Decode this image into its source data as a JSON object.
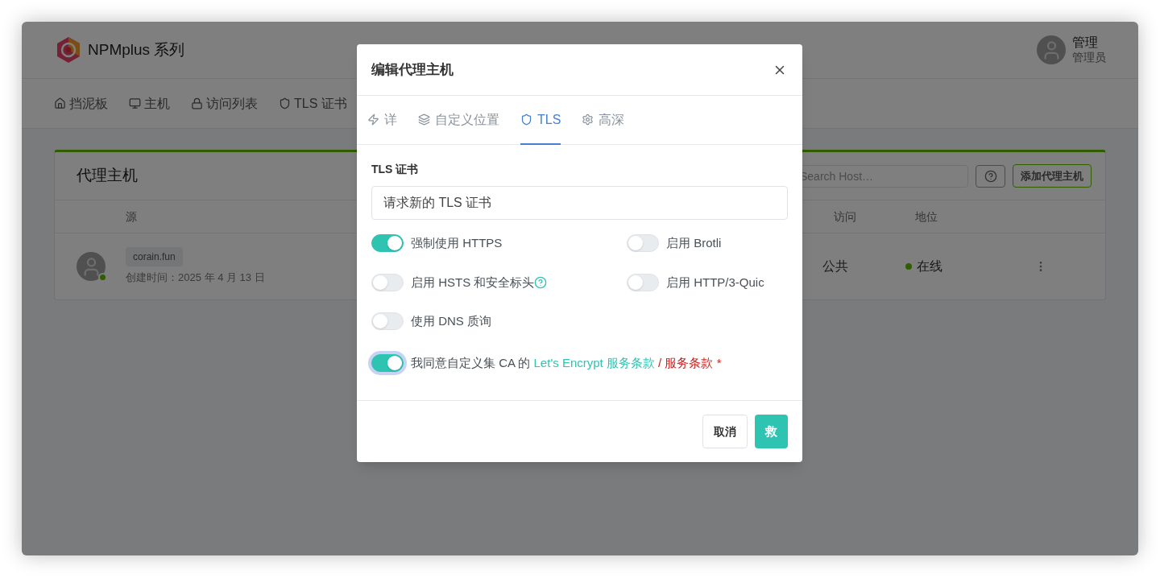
{
  "app": {
    "brand": "NPMplus 系列",
    "user": {
      "name": "管理",
      "role": "管理员"
    },
    "nav": [
      {
        "label": "挡泥板"
      },
      {
        "label": "主机"
      },
      {
        "label": "访问列表"
      },
      {
        "label": "TLS 证书"
      }
    ],
    "card": {
      "title": "代理主机",
      "search": {
        "placeholder": "Search Host…"
      },
      "add_button": "添加代理主机",
      "columns": [
        "源",
        "访问",
        "地位"
      ],
      "rows": [
        {
          "domain": "corain.fun",
          "created": "创建时间：2025 年 4 月 13 日",
          "access": "公共",
          "status": "在线",
          "online": true
        }
      ]
    }
  },
  "modal": {
    "title": "编辑代理主机",
    "tabs": [
      {
        "label": "详",
        "selected": false
      },
      {
        "label": "自定义位置",
        "selected": false
      },
      {
        "label": "TLS",
        "selected": true
      },
      {
        "label": "高深",
        "selected": false
      }
    ],
    "cert_label": "TLS 证书",
    "cert_value": "请求新的 TLS 证书",
    "options": [
      {
        "label": "强制使用 HTTPS",
        "on": true,
        "help": false
      },
      {
        "label": "启用 Brotli",
        "on": false,
        "help": false
      },
      {
        "label": "启用 HSTS 和安全标头",
        "on": false,
        "help": true
      },
      {
        "label": "启用 HTTP/3-Quic",
        "on": false,
        "help": false
      },
      {
        "label": "使用 DNS 质询",
        "on": false,
        "help": false
      }
    ],
    "agree": {
      "on": true,
      "text": "我同意自定义集 CA 的",
      "link": "Let's Encrypt 服务条款",
      "separator": "/",
      "link2": "服务条款",
      "required": "*"
    },
    "buttons": {
      "cancel": "取消",
      "save": "救"
    }
  }
}
